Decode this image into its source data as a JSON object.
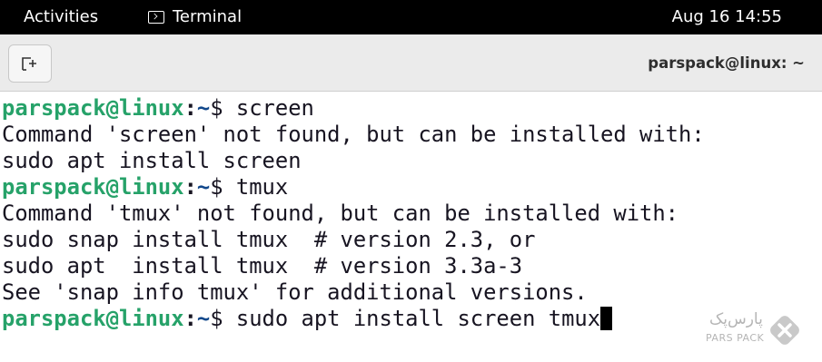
{
  "topbar": {
    "activities": "Activities",
    "app_name": "Terminal",
    "app_icon": "terminal-icon",
    "datetime": "Aug 16  14:55"
  },
  "window": {
    "title": "parspack@linux: ~",
    "new_tab_icon": "new-tab-icon"
  },
  "terminal": {
    "prompt": {
      "user": "parspack@linux",
      "sep": ":",
      "path": "~",
      "symbol": "$ "
    },
    "commands": [
      "screen",
      "tmux",
      "sudo apt install screen tmux"
    ],
    "outputs": [
      "Command 'screen' not found, but can be installed with:",
      "sudo apt install screen",
      "Command 'tmux' not found, but can be installed with:",
      "sudo snap install tmux  # version 2.3, or",
      "sudo apt  install tmux  # version 3.3a-3",
      "See 'snap info tmux' for additional versions."
    ]
  },
  "watermark": {
    "text_fa": "پارس‌پک",
    "text_en": "PARS PACK"
  }
}
